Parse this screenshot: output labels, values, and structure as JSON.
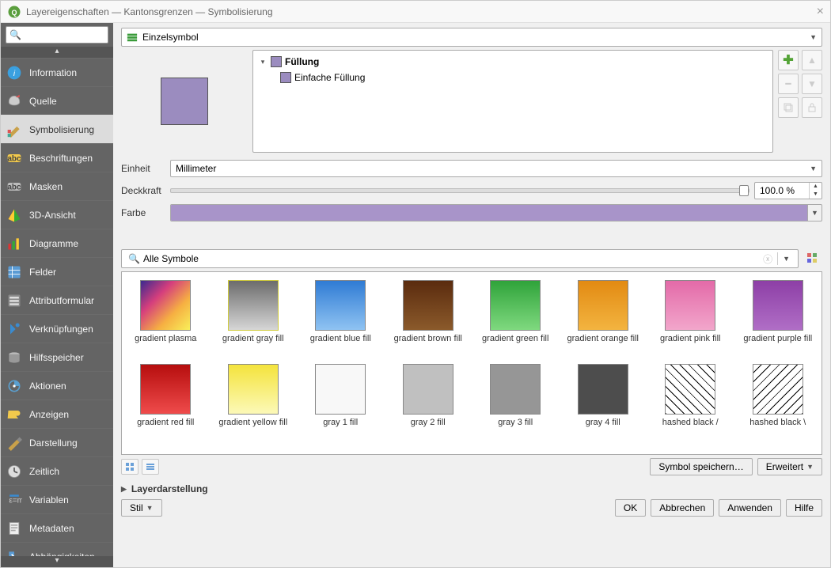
{
  "window": {
    "title": "Layereigenschaften — Kantonsgrenzen — Symbolisierung"
  },
  "sidebar": {
    "search_placeholder": "",
    "items": [
      {
        "label": "Information"
      },
      {
        "label": "Quelle"
      },
      {
        "label": "Symbolisierung"
      },
      {
        "label": "Beschriftungen"
      },
      {
        "label": "Masken"
      },
      {
        "label": "3D-Ansicht"
      },
      {
        "label": "Diagramme"
      },
      {
        "label": "Felder"
      },
      {
        "label": "Attributformular"
      },
      {
        "label": "Verknüpfungen"
      },
      {
        "label": "Hilfsspeicher"
      },
      {
        "label": "Aktionen"
      },
      {
        "label": "Anzeigen"
      },
      {
        "label": "Darstellung"
      },
      {
        "label": "Zeitlich"
      },
      {
        "label": "Variablen"
      },
      {
        "label": "Metadaten"
      },
      {
        "label": "Abhängigkeiten"
      }
    ]
  },
  "renderer": {
    "value": "Einzelsymbol"
  },
  "tree": {
    "root": "Füllung",
    "child": "Einfache Füllung"
  },
  "form": {
    "unit_label": "Einheit",
    "unit_value": "Millimeter",
    "opacity_label": "Deckkraft",
    "opacity_value": "100.0 %",
    "color_label": "Farbe",
    "color_value": "#a894c9"
  },
  "filter": {
    "value": "Alle Symbole"
  },
  "gallery": [
    {
      "label": "gradient plasma",
      "bg": "linear-gradient(135deg,#3b2a8f,#d53e7d,#f6b042,#f8f05a)"
    },
    {
      "label": "gradient  gray fill",
      "bg": "linear-gradient(180deg,#6c6c6c,#d6d6d6)",
      "border": "#d0cc3a"
    },
    {
      "label": "gradient blue fill",
      "bg": "linear-gradient(180deg,#2f7bd4,#8fc3f2)"
    },
    {
      "label": "gradient brown fill",
      "bg": "linear-gradient(180deg,#5a2b0e,#8b5a2b)"
    },
    {
      "label": "gradient green fill",
      "bg": "linear-gradient(180deg,#2fa33a,#7fd97f)"
    },
    {
      "label": "gradient orange fill",
      "bg": "linear-gradient(180deg,#e28a12,#f3b440)"
    },
    {
      "label": "gradient pink fill",
      "bg": "linear-gradient(180deg,#e36aa8,#f2a6cb)"
    },
    {
      "label": "gradient purple fill",
      "bg": "linear-gradient(180deg,#8d3fa6,#b06ec6)"
    },
    {
      "label": "gradient red fill",
      "bg": "linear-gradient(180deg,#b60e0e,#ef4b4b)"
    },
    {
      "label": "gradient yellow fill",
      "bg": "linear-gradient(180deg,#f4e33c,#fcf9b8)"
    },
    {
      "label": "gray 1 fill",
      "bg": "#f8f8f8"
    },
    {
      "label": "gray 2 fill",
      "bg": "#c0c0c0"
    },
    {
      "label": "gray 3 fill",
      "bg": "#969696"
    },
    {
      "label": "gray 4 fill",
      "bg": "#4d4d4d"
    },
    {
      "label": "hashed black /",
      "hatch": "fwd"
    },
    {
      "label": "hashed black \\",
      "hatch": "back"
    }
  ],
  "under_gallery": {
    "save": "Symbol speichern…",
    "advanced": "Erweitert"
  },
  "collapse": {
    "title": "Layerdarstellung"
  },
  "bottom": {
    "style": "Stil",
    "ok": "OK",
    "cancel": "Abbrechen",
    "apply": "Anwenden",
    "help": "Hilfe"
  }
}
